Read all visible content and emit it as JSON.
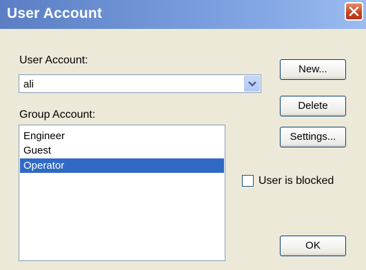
{
  "window": {
    "title": "User Account"
  },
  "form": {
    "user_account_label": "User Account:",
    "user_account_value": "ali",
    "group_account_label": "Group Account:",
    "groups": [
      "Engineer",
      "Guest",
      "Operator"
    ],
    "selected_group": "Operator",
    "user_blocked_label": "User is blocked",
    "user_blocked_checked": false
  },
  "buttons": {
    "new_label": "New...",
    "delete_label": "Delete",
    "settings_label": "Settings...",
    "ok_label": "OK"
  },
  "icons": {
    "close": "close-icon",
    "dropdown": "chevron-down-icon"
  },
  "colors": {
    "selection": "#316ac5",
    "close_button": "#c7421f"
  }
}
